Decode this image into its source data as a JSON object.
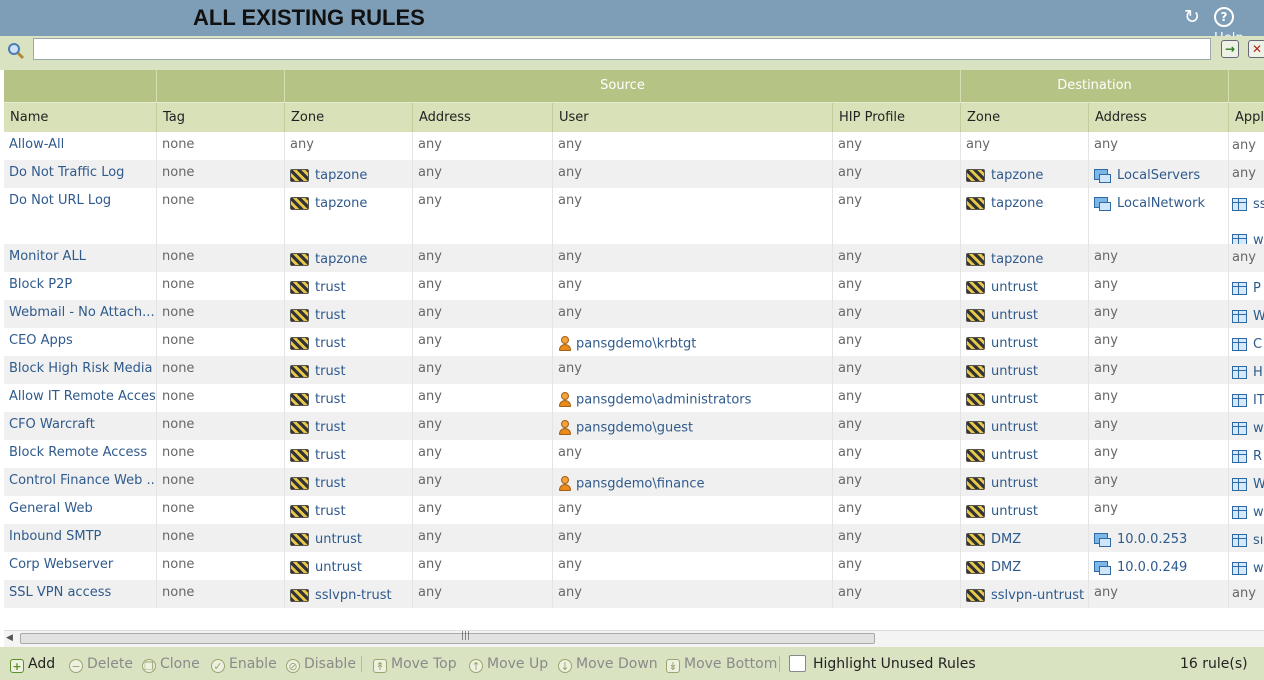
{
  "header": {
    "title": "ALL EXISTING RULES",
    "help_label": "Help"
  },
  "search": {
    "value": "",
    "placeholder": ""
  },
  "columns": {
    "group_source": "Source",
    "group_destination": "Destination",
    "name": "Name",
    "tag": "Tag",
    "src_zone": "Zone",
    "src_address": "Address",
    "user": "User",
    "hip": "HIP Profile",
    "dst_zone": "Zone",
    "dst_address": "Address",
    "application": "Appli"
  },
  "rules": [
    {
      "name": "Allow-All",
      "tag": "none",
      "src_zone": "any",
      "src_address": "any",
      "user": "any",
      "hip": "any",
      "dst_zone": "any",
      "dst_address": "any",
      "app": [
        "any"
      ]
    },
    {
      "name": "Do Not Traffic Log",
      "tag": "none",
      "src_zone": "tapzone",
      "src_address": "any",
      "user": "any",
      "hip": "any",
      "dst_zone": "tapzone",
      "dst_address": "LocalServers",
      "app": [
        "any"
      ]
    },
    {
      "name": "Do Not URL Log",
      "tag": "none",
      "src_zone": "tapzone",
      "src_address": "any",
      "user": "any",
      "hip": "any",
      "dst_zone": "tapzone",
      "dst_address": "LocalNetwork",
      "app": [
        "ss",
        "w"
      ]
    },
    {
      "name": "Monitor ALL",
      "tag": "none",
      "src_zone": "tapzone",
      "src_address": "any",
      "user": "any",
      "hip": "any",
      "dst_zone": "tapzone",
      "dst_address": "any",
      "app": [
        "any"
      ]
    },
    {
      "name": "Block P2P",
      "tag": "none",
      "src_zone": "trust",
      "src_address": "any",
      "user": "any",
      "hip": "any",
      "dst_zone": "untrust",
      "dst_address": "any",
      "app": [
        "P"
      ]
    },
    {
      "name": "Webmail - No Attach...",
      "tag": "none",
      "src_zone": "trust",
      "src_address": "any",
      "user": "any",
      "hip": "any",
      "dst_zone": "untrust",
      "dst_address": "any",
      "app": [
        "W"
      ]
    },
    {
      "name": "CEO Apps",
      "tag": "none",
      "src_zone": "trust",
      "src_address": "any",
      "user": "pansgdemo\\krbtgt",
      "hip": "any",
      "dst_zone": "untrust",
      "dst_address": "any",
      "app": [
        "C"
      ]
    },
    {
      "name": "Block High Risk Media",
      "tag": "none",
      "src_zone": "trust",
      "src_address": "any",
      "user": "any",
      "hip": "any",
      "dst_zone": "untrust",
      "dst_address": "any",
      "app": [
        "H"
      ]
    },
    {
      "name": "Allow IT Remote Access",
      "tag": "none",
      "src_zone": "trust",
      "src_address": "any",
      "user": "pansgdemo\\administrators",
      "hip": "any",
      "dst_zone": "untrust",
      "dst_address": "any",
      "app": [
        "IT"
      ]
    },
    {
      "name": "CFO Warcraft",
      "tag": "none",
      "src_zone": "trust",
      "src_address": "any",
      "user": "pansgdemo\\guest",
      "hip": "any",
      "dst_zone": "untrust",
      "dst_address": "any",
      "app": [
        "w"
      ]
    },
    {
      "name": "Block Remote Access",
      "tag": "none",
      "src_zone": "trust",
      "src_address": "any",
      "user": "any",
      "hip": "any",
      "dst_zone": "untrust",
      "dst_address": "any",
      "app": [
        "R"
      ]
    },
    {
      "name": "Control Finance Web ...",
      "tag": "none",
      "src_zone": "trust",
      "src_address": "any",
      "user": "pansgdemo\\finance",
      "hip": "any",
      "dst_zone": "untrust",
      "dst_address": "any",
      "app": [
        "W"
      ]
    },
    {
      "name": "General Web",
      "tag": "none",
      "src_zone": "trust",
      "src_address": "any",
      "user": "any",
      "hip": "any",
      "dst_zone": "untrust",
      "dst_address": "any",
      "app": [
        "w"
      ]
    },
    {
      "name": "Inbound SMTP",
      "tag": "none",
      "src_zone": "untrust",
      "src_address": "any",
      "user": "any",
      "hip": "any",
      "dst_zone": "DMZ",
      "dst_address": "10.0.0.253",
      "app": [
        "sı"
      ]
    },
    {
      "name": "Corp Webserver",
      "tag": "none",
      "src_zone": "untrust",
      "src_address": "any",
      "user": "any",
      "hip": "any",
      "dst_zone": "DMZ",
      "dst_address": "10.0.0.249",
      "app": [
        "w"
      ]
    },
    {
      "name": "SSL VPN access",
      "tag": "none",
      "src_zone": "sslvpn-trust",
      "src_address": "any",
      "user": "any",
      "hip": "any",
      "dst_zone": "sslvpn-untrust",
      "dst_address": "any",
      "app": [
        "any"
      ]
    }
  ],
  "footer": {
    "add": "Add",
    "delete": "Delete",
    "clone": "Clone",
    "enable": "Enable",
    "disable": "Disable",
    "move_top": "Move Top",
    "move_up": "Move Up",
    "move_down": "Move Down",
    "move_bottom": "Move Bottom",
    "highlight_unused": "Highlight Unused Rules",
    "highlight_checked": false,
    "rule_count": "16 rule(s)"
  }
}
